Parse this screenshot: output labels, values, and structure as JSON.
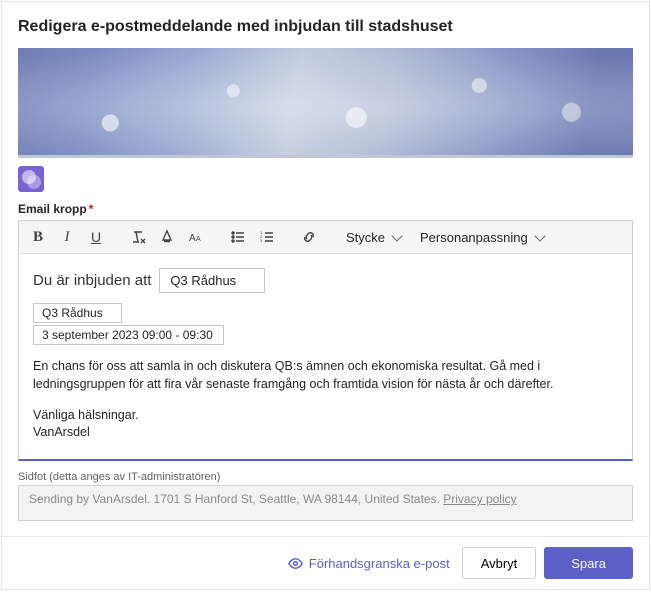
{
  "title": "Redigera e-postmeddelande med inbjudan till stadshuset",
  "body_label": "Email kropp",
  "toolbar": {
    "style_dropdown": "Stycke",
    "personalize": "Personanpassning"
  },
  "content": {
    "invite_prefix": "Du är inbjuden att",
    "event_chip": "Q3 Rådhus",
    "event_chip2": "Q3 Rådhus",
    "datetime_chip": "3 september 2023 09:00 - 09:30",
    "paragraph": "En chans för oss att samla in och diskutera QB:s ämnen och ekonomiska resultat. Gå med i ledningsgruppen för att fira vår senaste framgång och framtida vision för nästa år och därefter.",
    "signoff": "Vänliga hälsningar.",
    "sender": "VanArsdel"
  },
  "footer": {
    "label": "Sidfot (detta anges av IT-administratören)",
    "text": "Sending by VanArsdel. 1701 S Hanford St, Seattle, WA 98144, United States.",
    "privacy": "Privacy policy"
  },
  "actions": {
    "preview": "Förhandsgranska e-post",
    "cancel": "Avbryt",
    "save": "Spara"
  }
}
